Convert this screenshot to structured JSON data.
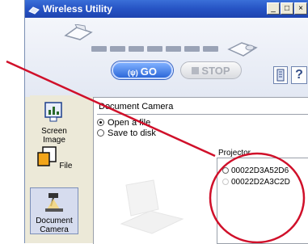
{
  "window": {
    "title": "Wireless Utility",
    "minimize": "_",
    "maximize": "□",
    "close": "×"
  },
  "toolbar": {
    "go_label": "GO",
    "go_icon": "(ψ)",
    "stop_label": "STOP",
    "help_label": "?"
  },
  "sidebar": {
    "items": [
      {
        "label": "Screen Image",
        "icon": "screen-image-icon"
      },
      {
        "label": "File",
        "icon": "file-icon"
      },
      {
        "label_line1": "Document",
        "label_line2": "Camera",
        "icon": "document-camera-icon",
        "selected": true
      }
    ]
  },
  "panel": {
    "title": "Document Camera",
    "options": [
      {
        "label": "Open a file",
        "selected": true
      },
      {
        "label": "Save to disk",
        "selected": false
      }
    ],
    "projector": {
      "label": "Projector",
      "items": [
        "00022D3A52D6",
        "00022D2A3C2D"
      ]
    }
  },
  "annotation": {
    "color": "#d0102a"
  }
}
